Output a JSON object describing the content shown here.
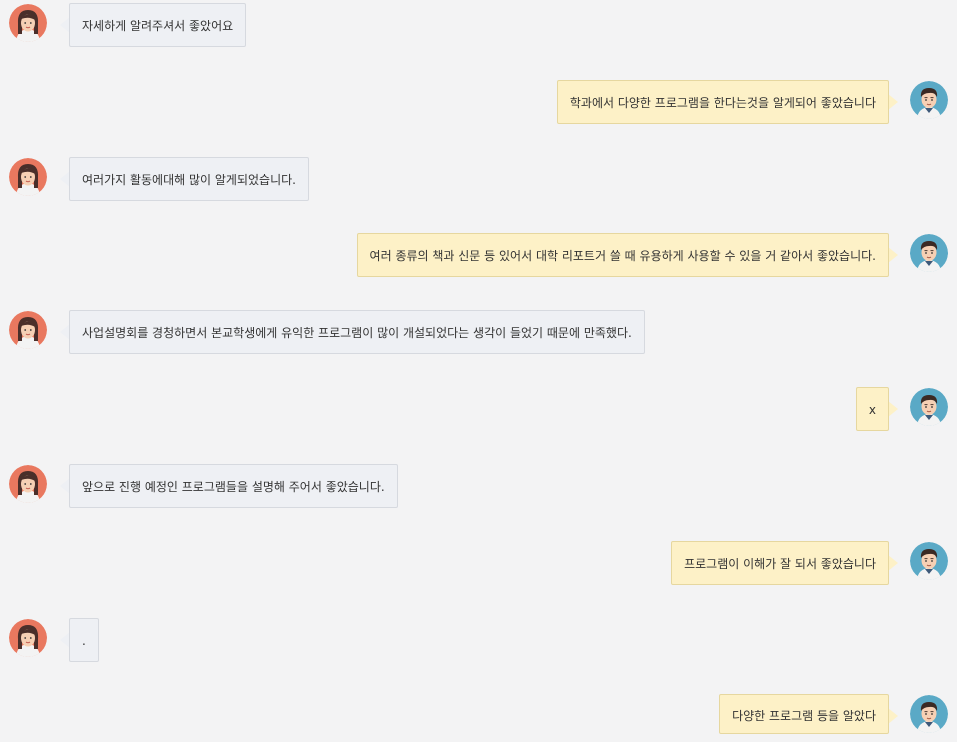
{
  "messages": [
    {
      "side": "left",
      "avatar": "female-avatar-icon",
      "text": "자세하게 알려주셔서 좋았어요"
    },
    {
      "side": "right",
      "avatar": "male-avatar-icon",
      "text": "학과에서 다양한 프로그램을 한다는것을 알게되어 좋았습니다"
    },
    {
      "side": "left",
      "avatar": "female-avatar-icon",
      "text": "여러가지 활동에대해 많이 알게되었습니다."
    },
    {
      "side": "right",
      "avatar": "male-avatar-icon",
      "text": "여러 종류의 책과 신문 등 있어서 대학 리포트거 쓸 때 유용하게 사용할 수 있을 거 같아서 좋았습니다."
    },
    {
      "side": "left",
      "avatar": "female-avatar-icon",
      "text": "사업설명회를 경청하면서 본교학생에게 유익한 프로그램이 많이 개설되었다는 생각이 들었기 때문에 만족했다."
    },
    {
      "side": "right",
      "avatar": "male-avatar-icon",
      "text": "x"
    },
    {
      "side": "left",
      "avatar": "female-avatar-icon",
      "text": "앞으로 진행 예정인 프로그램들을 설명해 주어서 좋았습니다."
    },
    {
      "side": "right",
      "avatar": "male-avatar-icon",
      "text": "프로그램이 이해가 잘 되서 좋았습니다"
    },
    {
      "side": "left",
      "avatar": "female-avatar-icon",
      "text": "."
    },
    {
      "side": "right",
      "avatar": "male-avatar-icon",
      "text": "다양한 프로그램 등을 알았다"
    }
  ],
  "colors": {
    "background": "#f3f3f4",
    "left_bubble": "#eef0f4",
    "right_bubble": "#fdf1c7",
    "female_avatar_bg": "#e9785f",
    "male_avatar_bg": "#5aa9c6"
  }
}
